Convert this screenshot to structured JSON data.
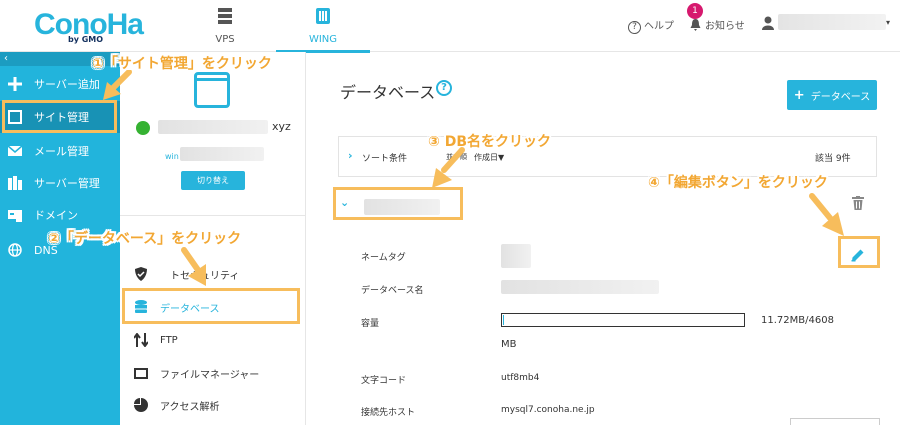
{
  "header": {
    "logo": "ConoHa",
    "logo_sub": "by GMO",
    "tabs": [
      {
        "label": "VPS",
        "icon": "server-icon",
        "active": false
      },
      {
        "label": "WING",
        "icon": "wing-icon",
        "active": true
      }
    ],
    "help_label": "ヘルプ",
    "notice_label": "お知らせ",
    "notice_badge": "1"
  },
  "sidebar": {
    "collapse_icon": "‹",
    "items": [
      {
        "label": "サーバー追加",
        "icon": "plus-icon",
        "active": false
      },
      {
        "label": "サイト管理",
        "icon": "window-icon",
        "active": true
      },
      {
        "label": "メール管理",
        "icon": "mail-icon",
        "active": false
      },
      {
        "label": "サーバー管理",
        "icon": "server-manage-icon",
        "active": false
      },
      {
        "label": "ドメイン",
        "icon": "domain-icon",
        "active": false
      },
      {
        "label": "DNS",
        "icon": "globe-icon",
        "active": false
      }
    ]
  },
  "subpanel": {
    "domain_suffix": "xyz",
    "wing_prefix": "win",
    "switch_label": "切り替え",
    "menu": [
      {
        "label": "トセキュリティ",
        "icon": "shield-icon",
        "active": false
      },
      {
        "label": "データベース",
        "icon": "database-icon",
        "active": true
      },
      {
        "label": "FTP",
        "icon": "ftp-icon",
        "active": false
      },
      {
        "label": "ファイルマネージャー",
        "icon": "folder-icon",
        "active": false
      },
      {
        "label": "アクセス解析",
        "icon": "pie-icon",
        "active": false
      }
    ]
  },
  "main": {
    "title": "データベース",
    "add_button": "データベース",
    "sort": {
      "label": "ソート条件",
      "option_name": "並び順",
      "option_date": "作成日▼",
      "count": "該当 9件"
    },
    "details": [
      {
        "label": "ネームタグ",
        "value": ""
      },
      {
        "label": "データベース名",
        "value": ""
      },
      {
        "label": "容量",
        "value": ""
      },
      {
        "label": "文字コード",
        "value": "utf8mb4"
      },
      {
        "label": "接続先ホスト",
        "value": "mysql7.conoha.ne.jp"
      }
    ],
    "capacity_text": "11.72MB/4608",
    "capacity_unit": "MB",
    "capacity_used_fraction": 0.0025
  },
  "annotations": {
    "step1": "①「サイト管理」をクリック",
    "step2": "②「データベース」をクリック",
    "step3": "③ DB名をクリック",
    "step4": "④「編集ボタン」をクリック"
  },
  "colors": {
    "brand": "#27b4dc",
    "sidebar_bg": "#22b4dc",
    "annotation": "#f2a733",
    "highlight": "#f7bd5c",
    "badge": "#d6196e"
  }
}
